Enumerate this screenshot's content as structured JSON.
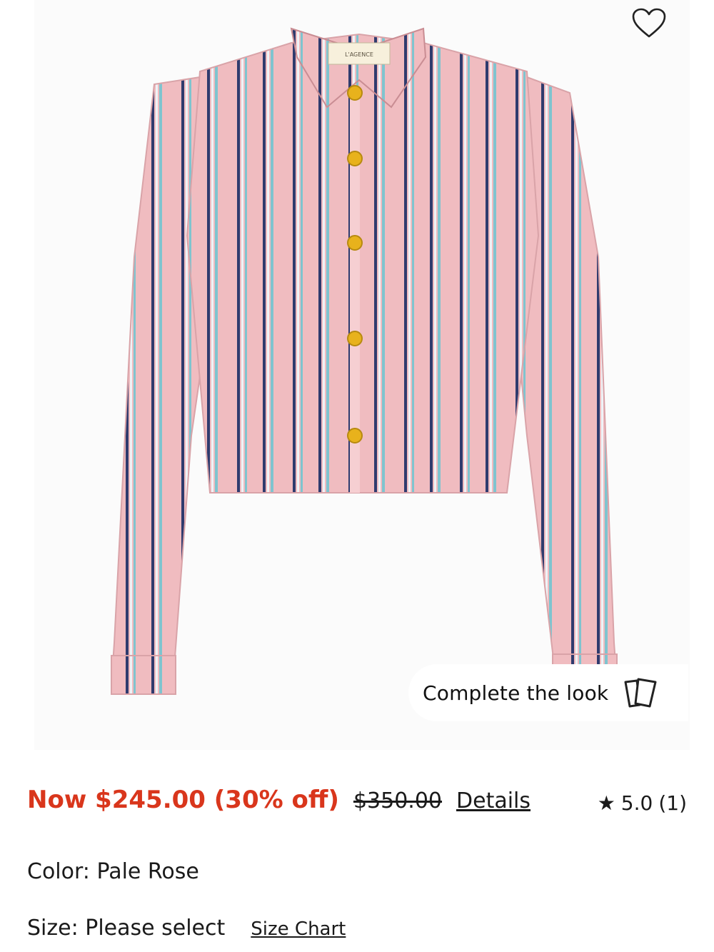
{
  "product": {
    "image_alt": "Pink striped cropped button-down shirt",
    "brand_tag": "L'AGENCE",
    "favorite_icon": "heart-outline-icon",
    "complete_look": {
      "label": "Complete the look",
      "icon": "cards-icon"
    }
  },
  "pricing": {
    "now": "Now $245.00 (30% off)",
    "was": "$350.00",
    "details_label": "Details",
    "sale_color": "#d9361c"
  },
  "rating": {
    "value": "5.0",
    "count": "(1)",
    "icon": "star-icon"
  },
  "color": {
    "label": "Color:",
    "value": "Pale Rose"
  },
  "size": {
    "label": "Size:",
    "value": "Please select",
    "chart_label": "Size Chart"
  }
}
